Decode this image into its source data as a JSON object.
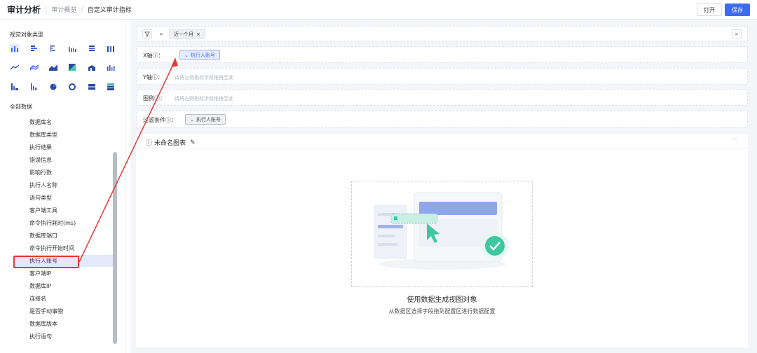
{
  "header": {
    "app_title": "审计分析",
    "breadcrumbs": [
      "审计概览",
      "自定义审计指标"
    ],
    "open_label": "打开",
    "save_label": "保存"
  },
  "left_panel": {
    "view_type_title": "视觉对象类型",
    "chart_icons": [
      "bar-chart-icon",
      "stacked-bar-icon",
      "horizontal-bar-icon",
      "column-group-icon",
      "stacked-horizontal-icon",
      "grouped-bar-icon",
      "line-chart-icon",
      "multi-line-icon",
      "area-chart-icon",
      "heatmap-icon",
      "stacked-area-icon",
      "mixed-column-icon",
      "waterfall-icon",
      "funnel-icon",
      "pie-chart-icon",
      "donut-chart-icon",
      "card-icon",
      "table-icon"
    ],
    "all_data_title": "全部数据",
    "fields": [
      "数据库名",
      "数据库类型",
      "执行结果",
      "错误信息",
      "影响行数",
      "执行人名称",
      "语句类型",
      "客户端工具",
      "命令执行耗时(ms)",
      "数据库端口",
      "命令执行开始时间",
      "执行人账号",
      "客户端IP",
      "数据库IP",
      "连接名",
      "是否手动事物",
      "数据库版本",
      "执行语句"
    ],
    "selected_field": "执行人账号"
  },
  "filters_bar": {
    "filter_tag": "近一个月"
  },
  "config": {
    "x_axis_label": "X轴ⓘ：",
    "x_axis_chip": "执行人账号",
    "y_axis_label": "Y轴ⓘ：",
    "y_axis_placeholder": "请将左侧指标字段拖拽至此",
    "legend_label": "图例ⓘ：",
    "legend_placeholder": "请将左侧指标字段拖拽至此",
    "filter_label": "过滤条件ⓘ：",
    "filter_chip": "执行人账号"
  },
  "chart_card": {
    "title": "未命名图表",
    "empty_title": "使用数据生成视图对象",
    "empty_subtitle": "从数据区选择字段拖到配置区进行数据配置"
  },
  "colors": {
    "accent": "#3d6bf5",
    "annotation": "#e53935",
    "success": "#3ec7a0"
  }
}
